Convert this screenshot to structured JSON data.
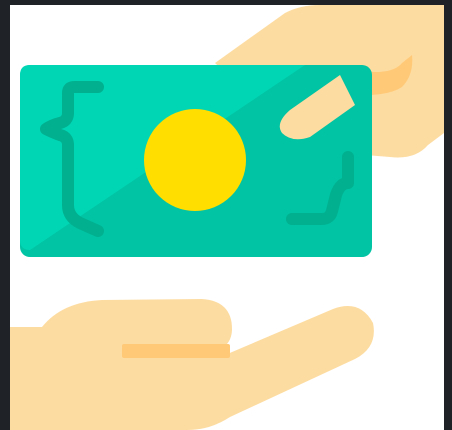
{
  "illustration": {
    "icon": "money-payment-icon",
    "colors": {
      "frame": "#1f2227",
      "background": "#ffffff",
      "bill_light": "#00d6b4",
      "bill_dark": "#00c4a3",
      "bill_ornament": "#00b08f",
      "coin": "#ffde00",
      "hand_skin": "#fddca1",
      "hand_shadow": "#ffc978"
    }
  }
}
